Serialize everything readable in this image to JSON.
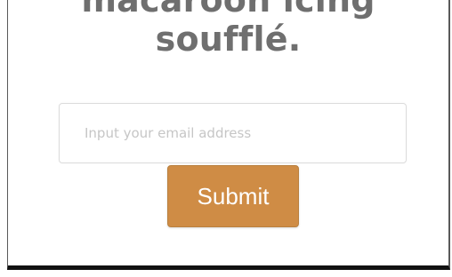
{
  "hero": {
    "heading_line_1": "macaroon icing",
    "heading_line_2": "soufflé."
  },
  "signup_form": {
    "email_placeholder": "Input your email address",
    "email_value": "",
    "submit_label": "Submit"
  },
  "colors": {
    "submit_background": "#cf8c45",
    "heading_text": "#6f6f6f"
  }
}
